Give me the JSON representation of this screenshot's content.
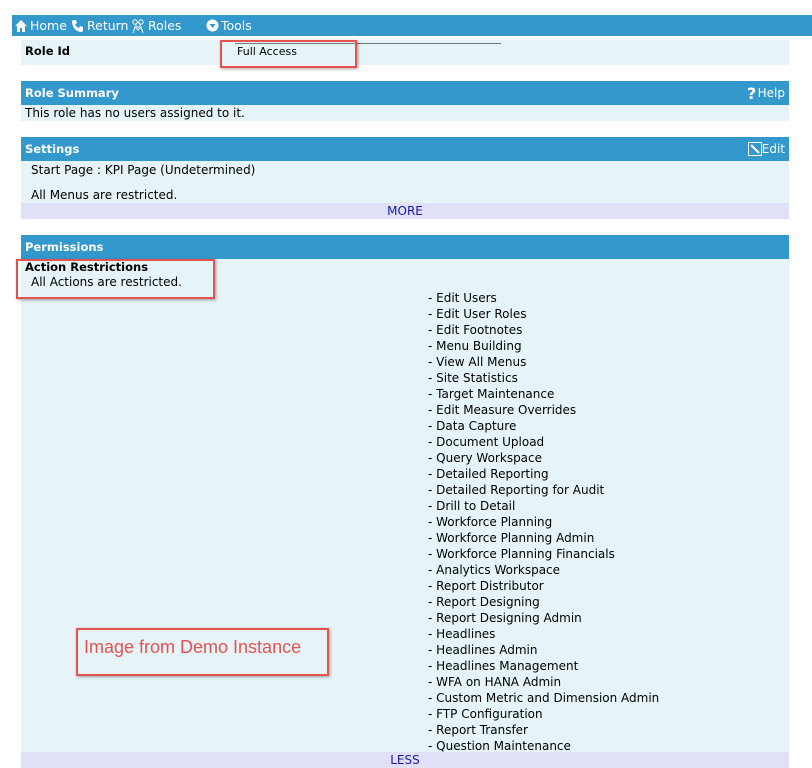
{
  "toolbar": {
    "home": "Home",
    "return": "Return",
    "roles": "Roles",
    "tools": "Tools"
  },
  "role_id": {
    "label": "Role Id",
    "value": "Full Access"
  },
  "role_summary": {
    "title": "Role Summary",
    "help": "Help",
    "text": "This role has no users assigned to it."
  },
  "settings": {
    "title": "Settings",
    "edit": "Edit",
    "start_page": "Start Page : KPI Page (Undetermined)",
    "menus": "All Menus are restricted.",
    "more": "MORE"
  },
  "permissions": {
    "title": "Permissions",
    "action_restrictions_heading": "Action Restrictions",
    "action_restrictions_text": "All Actions are restricted.",
    "items": [
      "- Edit Users",
      "- Edit User Roles",
      "- Edit Footnotes",
      "- Menu Building",
      "- View All Menus",
      "- Site Statistics",
      "- Target Maintenance",
      "- Edit Measure Overrides",
      "- Data Capture",
      "- Document Upload",
      "- Query Workspace",
      "- Detailed Reporting",
      "- Detailed Reporting for Audit",
      "- Drill to Detail",
      "- Workforce Planning",
      "- Workforce Planning Admin",
      "- Workforce Planning Financials",
      "- Analytics Workspace",
      "- Report Distributor",
      "- Report Designing",
      "- Report Designing Admin",
      "- Headlines",
      "- Headlines Admin",
      "- Headlines Management",
      "- WFA on HANA Admin",
      "- Custom Metric and Dimension Admin",
      "- FTP Configuration",
      "- Report Transfer",
      "- Question Maintenance"
    ],
    "less": "LESS"
  },
  "annotation": "Image from Demo Instance",
  "colors": {
    "header_blue": "#3399cc",
    "panel_light": "#e6f4f8",
    "more_bar": "#e0e0f8",
    "highlight_red": "#e4534f"
  },
  "icons": [
    "home-icon",
    "return-icon",
    "roles-icon",
    "tools-icon",
    "help-icon",
    "edit-icon"
  ]
}
